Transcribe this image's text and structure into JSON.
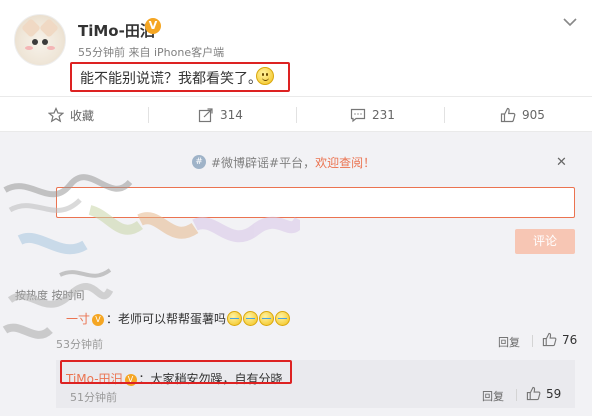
{
  "post": {
    "author": "TiMo-田汨",
    "verified_icon": "verified-v-icon",
    "time": "55分钟前",
    "source": "来自 iPhone客户端",
    "content": "能不能别说谎？我都看笑了。",
    "emoji": "smile-emoji-icon"
  },
  "actions": {
    "favorite_label": "收藏",
    "share_count": "314",
    "comment_count": "231",
    "like_count": "905"
  },
  "notice": {
    "text": "#微博辟谣#平台，",
    "link": "欢迎查阅！"
  },
  "comment_form": {
    "placeholder": "",
    "submit_label": "评论"
  },
  "sort_bar": {
    "label": "按热度 按时间"
  },
  "comments": [
    {
      "author": "一寸",
      "text": "：老师可以帮帮蛋薯吗",
      "time": "53分钟前",
      "reply_label": "回复",
      "likes": "76"
    }
  ],
  "replies": [
    {
      "author": "TiMo-田汨",
      "text": "：大家稍安勿躁，自有分晓",
      "time": "51分钟前",
      "reply_label": "回复",
      "likes": "59"
    }
  ],
  "colors": {
    "accent": "#eb7350",
    "highlight_box": "#dd2222",
    "verified": "#f5a623"
  }
}
